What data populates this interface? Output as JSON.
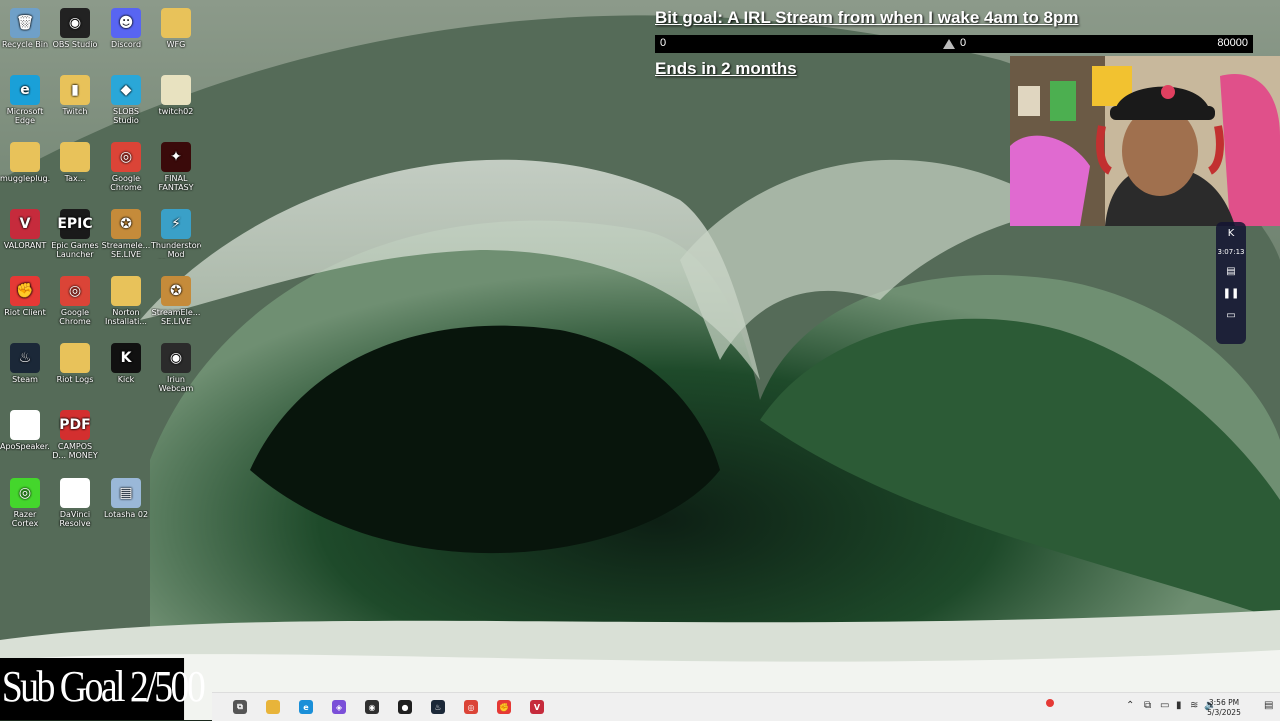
{
  "desktop": {
    "icons": [
      {
        "label": "Recycle Bin",
        "glyph": "🗑",
        "color": "#6fa0c8"
      },
      {
        "label": "OBS Studio",
        "glyph": "◉",
        "color": "#222222"
      },
      {
        "label": "Discord",
        "glyph": "☻",
        "color": "#5865f2"
      },
      {
        "label": "WFG",
        "glyph": "",
        "color": "#e8c25a"
      },
      {
        "label": "Microsoft Edge",
        "glyph": "e",
        "color": "#1aa0d8"
      },
      {
        "label": "Twitch",
        "glyph": "▮",
        "color": "#e8c25a"
      },
      {
        "label": "SLOBS Studio",
        "glyph": "◆",
        "color": "#2aa7d8"
      },
      {
        "label": "twitch02",
        "glyph": "",
        "color": "#e8e2c0"
      },
      {
        "label": "muggleplug...",
        "glyph": "",
        "color": "#e8c25a"
      },
      {
        "label": "Tax...",
        "glyph": "",
        "color": "#e8c25a"
      },
      {
        "label": "Google Chrome",
        "glyph": "◎",
        "color": "#db4437"
      },
      {
        "label": "FINAL FANTASY XI...",
        "glyph": "✦",
        "color": "#3a0a0a"
      },
      {
        "label": "VALORANT",
        "glyph": "V",
        "color": "#c62b3c"
      },
      {
        "label": "Epic Games Launcher",
        "glyph": "EPIC",
        "color": "#1a1a1a"
      },
      {
        "label": "Streamele... SE.LIVE",
        "glyph": "✪",
        "color": "#c58b3a"
      },
      {
        "label": "Thunderstore Mod Manager",
        "glyph": "⚡",
        "color": "#3aa0c8"
      },
      {
        "label": "Riot Client",
        "glyph": "✊",
        "color": "#e53935"
      },
      {
        "label": "Google Chrome",
        "glyph": "◎",
        "color": "#db4437"
      },
      {
        "label": "Norton Installati...",
        "glyph": "",
        "color": "#e8c25a"
      },
      {
        "label": "StreamEle... SE.LIVE",
        "glyph": "✪",
        "color": "#c58b3a"
      },
      {
        "label": "Steam",
        "glyph": "♨",
        "color": "#1b2838"
      },
      {
        "label": "Riot Logs",
        "glyph": "",
        "color": "#e8c25a"
      },
      {
        "label": "Kick",
        "glyph": "K",
        "color": "#111111"
      },
      {
        "label": "Iriun Webcam",
        "glyph": "◉",
        "color": "#2b2b2b"
      },
      {
        "label": "ApoSpeaker...",
        "glyph": "",
        "color": "#ffffff"
      },
      {
        "label": "CAMPOS D... MONEY L...",
        "glyph": "PDF",
        "color": "#d32f2f"
      },
      {
        "label": "Razer Cortex",
        "glyph": "◎",
        "color": "#44d62c"
      },
      {
        "label": "DaVinci Resolve",
        "glyph": "",
        "color": "#ffffff"
      },
      {
        "label": "Lotasha 02",
        "glyph": "▤",
        "color": "#9ab8d8"
      }
    ]
  },
  "bit_goal": {
    "title": "Bit goal: A IRL Stream from when I wake 4am to 8pm",
    "min": "0",
    "current": "0",
    "max": "80000",
    "progress_fraction": 0,
    "ends": "Ends in 2 months"
  },
  "recorder": {
    "logo": "K",
    "time": "3:07:13",
    "icons": [
      "notes-icon",
      "pause-icon",
      "camera-icon"
    ]
  },
  "sub_goal": "Sub Goal 2/500",
  "taskbar": {
    "apps": [
      {
        "name": "task-view",
        "glyph": "⧉",
        "color": "#555555"
      },
      {
        "name": "file-explorer",
        "glyph": "",
        "color": "#e8b43a"
      },
      {
        "name": "edge",
        "glyph": "e",
        "color": "#1a8fd8"
      },
      {
        "name": "app-purple",
        "glyph": "◈",
        "color": "#7b4fd8"
      },
      {
        "name": "obs",
        "glyph": "◉",
        "color": "#303030"
      },
      {
        "name": "kick-extension",
        "glyph": "●",
        "color": "#202020"
      },
      {
        "name": "steam",
        "glyph": "♨",
        "color": "#1b2838"
      },
      {
        "name": "chrome",
        "glyph": "◎",
        "color": "#db4437"
      },
      {
        "name": "riot",
        "glyph": "✊",
        "color": "#e53935"
      },
      {
        "name": "valorant",
        "glyph": "V",
        "color": "#c62b3c"
      }
    ],
    "time": "3:56 PM",
    "date": "5/3/2025"
  }
}
